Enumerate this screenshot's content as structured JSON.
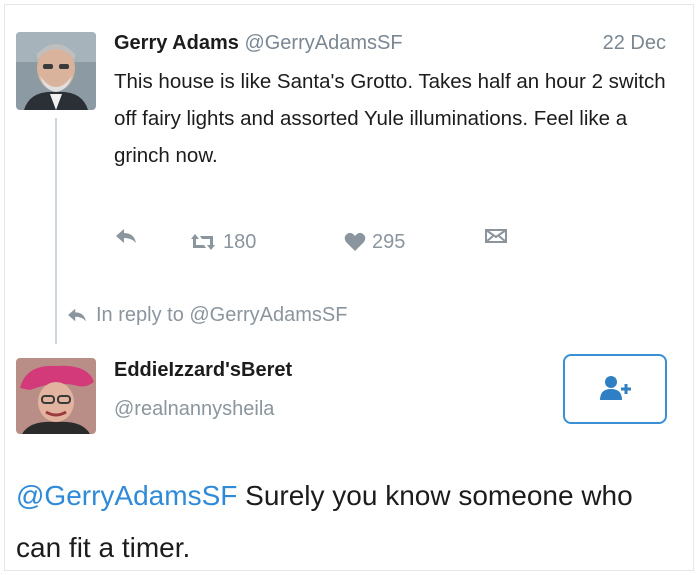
{
  "tweet": {
    "author_name": "Gerry Adams",
    "author_handle": "@GerryAdamsSF",
    "date": "22 Dec",
    "text": "This house is like Santa's Grotto. Takes half an hour 2 switch off fairy lights and assorted Yule illuminations. Feel like a grinch now.",
    "retweets": "180",
    "likes": "295"
  },
  "reply_context": {
    "text": "In reply to @GerryAdamsSF"
  },
  "reply": {
    "author_name": "EddieIzzard'sBeret",
    "author_handle": "@realnannysheila",
    "mention": "@GerryAdamsSF",
    "text": " Surely you know someone who can fit a timer."
  },
  "icons": {
    "reply": "reply-arrow-icon",
    "retweet": "retweet-icon",
    "like": "heart-icon",
    "dm": "direct-message-icon",
    "follow": "add-user-icon"
  },
  "colors": {
    "mention": "#2f8ad8",
    "follow_border": "#3b8fd4",
    "secondary_text": "#8a959e"
  }
}
